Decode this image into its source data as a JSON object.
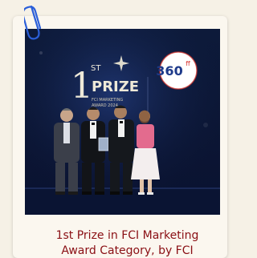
{
  "card": {
    "caption_line1": "1st Prize in FCI Marketing",
    "caption_line2": "Award Category, by FCI"
  },
  "photo_screen": {
    "prize_number": "1",
    "prize_suffix": "ST",
    "prize_word": "PRIZE",
    "prize_small_line1": "FCI MARKETING",
    "prize_small_line2": "AWARD 2024",
    "logo_text": "360",
    "logo_sup": "ff"
  },
  "colors": {
    "caption": "#8a0f14",
    "clip": "#2b5fd9",
    "screen_bg": "#0f1f44",
    "logo_accent": "#d6302a"
  }
}
